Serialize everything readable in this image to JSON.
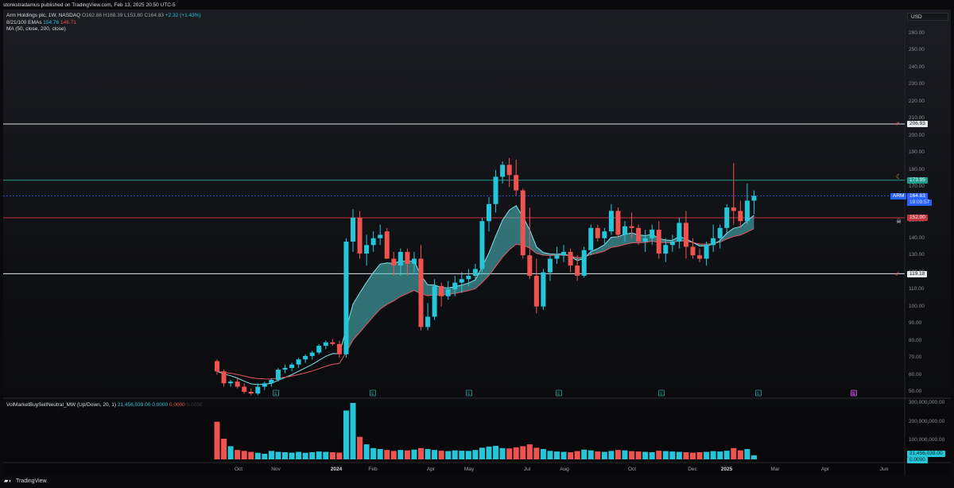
{
  "header": {
    "publish_line": "stonkstradamus published on TradingView.com, Feb 13, 2025 20:50 UTC-5"
  },
  "legend": {
    "symbol_line": "Arm Holdings plc, 1W, NASDAQ",
    "open": "O162.86",
    "high": "H168.39",
    "low": "L153.80",
    "close": "C164.83",
    "change": "+2.32 (+1.43%)",
    "ema_label": "8/21/100 EMAs",
    "ema_fast": "154.76",
    "ema_slow": "146.71",
    "ma_label": "MA (50, close, 200, close)",
    "vol_label": "VolMarketBuySellNeutral_MW (Up/Down, 20, 1)",
    "vol_v1": "21,456,039.00",
    "vol_v2": "0.0000",
    "vol_v3": "0.0000",
    "vol_v4": "0.0000"
  },
  "price_axis": {
    "currency": "USD",
    "ticks": [
      "260.00",
      "250.00",
      "240.00",
      "230.00",
      "220.00",
      "210.00",
      "200.00",
      "190.00",
      "180.00",
      "170.00",
      "160.00",
      "150.00",
      "140.00",
      "130.00",
      "120.00",
      "110.00",
      "100.00",
      "90.00",
      "80.00",
      "70.00",
      "60.00",
      "50.00"
    ],
    "badges": {
      "line_top": "206.93",
      "line_green": "173.95",
      "symbol": "ARM",
      "last": "164.83",
      "countdown": "19:09:57",
      "line_red": "152.00",
      "line_bottom": "119.18"
    }
  },
  "volume_axis": {
    "ticks": [
      "300,000,000.00",
      "200,000,000.00",
      "100,000,000.00"
    ],
    "value_badge": "21,456,039.00",
    "zero_badge": "0.0000"
  },
  "time_axis": {
    "labels": [
      "Oct",
      "Nov",
      "2024",
      "Feb",
      "Apr",
      "May",
      "Jul",
      "Aug",
      "Oct",
      "Dec",
      "2025",
      "Mar",
      "Apr",
      "Jun"
    ]
  },
  "events": {
    "earnings_label": "E"
  },
  "footer": {
    "brand": "TradingView"
  },
  "colors": {
    "up": "#26c6da",
    "down": "#ef5350",
    "line_white": "#dfe3ea",
    "line_green": "#1f9c8c",
    "line_red": "#c6353f",
    "band_fill": "#4fc3c9"
  },
  "chart_data": {
    "type": "candlestick",
    "interval": "1W",
    "price_scale": [
      50,
      265
    ],
    "horizontal_levels": [
      206.93,
      173.95,
      152.0,
      119.18
    ],
    "last_price": 164.83,
    "candles_ohlc": [
      [
        68,
        69,
        60,
        62
      ],
      [
        62,
        63,
        53,
        55
      ],
      [
        55,
        57,
        53,
        56
      ],
      [
        56,
        58,
        52,
        53
      ],
      [
        53,
        55,
        49,
        50
      ],
      [
        50,
        52,
        48,
        49
      ],
      [
        49,
        55,
        48,
        53
      ],
      [
        53,
        56,
        51,
        55
      ],
      [
        55,
        58,
        53,
        57
      ],
      [
        57,
        64,
        56,
        63
      ],
      [
        63,
        66,
        61,
        64
      ],
      [
        64,
        67,
        62,
        66
      ],
      [
        66,
        70,
        64,
        69
      ],
      [
        69,
        72,
        67,
        71
      ],
      [
        71,
        74,
        69,
        73
      ],
      [
        73,
        78,
        72,
        77
      ],
      [
        77,
        80,
        75,
        79
      ],
      [
        79,
        81,
        77,
        78
      ],
      [
        78,
        80,
        70,
        72
      ],
      [
        72,
        140,
        70,
        138
      ],
      [
        138,
        157,
        132,
        152
      ],
      [
        152,
        156,
        128,
        131
      ],
      [
        131,
        142,
        124,
        136
      ],
      [
        136,
        144,
        132,
        140
      ],
      [
        140,
        148,
        136,
        142
      ],
      [
        144,
        146,
        128,
        128
      ],
      [
        128,
        132,
        118,
        124
      ],
      [
        124,
        134,
        118,
        132
      ],
      [
        132,
        134,
        118,
        125
      ],
      [
        125,
        132,
        120,
        128
      ],
      [
        128,
        136,
        86,
        88
      ],
      [
        88,
        102,
        86,
        94
      ],
      [
        94,
        116,
        92,
        112
      ],
      [
        112,
        114,
        100,
        106
      ],
      [
        106,
        115,
        104,
        110
      ],
      [
        110,
        118,
        106,
        114
      ],
      [
        114,
        120,
        108,
        116
      ],
      [
        116,
        122,
        112,
        118
      ],
      [
        118,
        125,
        115,
        122
      ],
      [
        122,
        152,
        120,
        150
      ],
      [
        150,
        164,
        144,
        160
      ],
      [
        160,
        180,
        155,
        176
      ],
      [
        176,
        185,
        172,
        183
      ],
      [
        183,
        187,
        170,
        177
      ],
      [
        177,
        186,
        165,
        168
      ],
      [
        168,
        169,
        128,
        130
      ],
      [
        130,
        158,
        116,
        118
      ],
      [
        118,
        128,
        96,
        100
      ],
      [
        100,
        122,
        98,
        120
      ],
      [
        120,
        130,
        115,
        128
      ],
      [
        128,
        135,
        125,
        130
      ],
      [
        130,
        136,
        126,
        132
      ],
      [
        132,
        134,
        120,
        124
      ],
      [
        124,
        130,
        115,
        118
      ],
      [
        118,
        135,
        117,
        133
      ],
      [
        133,
        148,
        130,
        146
      ],
      [
        146,
        148,
        138,
        140
      ],
      [
        140,
        146,
        136,
        144
      ],
      [
        144,
        160,
        142,
        156
      ],
      [
        156,
        158,
        140,
        142
      ],
      [
        142,
        150,
        138,
        147
      ],
      [
        147,
        155,
        140,
        146
      ],
      [
        146,
        148,
        136,
        138
      ],
      [
        138,
        145,
        132,
        140
      ],
      [
        140,
        148,
        136,
        145
      ],
      [
        145,
        150,
        128,
        131
      ],
      [
        131,
        140,
        126,
        136
      ],
      [
        136,
        142,
        132,
        138
      ],
      [
        138,
        152,
        134,
        149
      ],
      [
        149,
        156,
        128,
        135
      ],
      [
        135,
        140,
        128,
        130
      ],
      [
        130,
        134,
        126,
        128
      ],
      [
        128,
        138,
        124,
        136
      ],
      [
        136,
        148,
        132,
        140
      ],
      [
        140,
        148,
        134,
        146
      ],
      [
        146,
        160,
        142,
        158
      ],
      [
        158,
        184,
        148,
        156
      ],
      [
        156,
        162,
        146,
        150
      ],
      [
        150,
        172,
        148,
        162
      ],
      [
        162,
        168,
        154,
        164.83
      ]
    ],
    "volume_millions": [
      200,
      110,
      70,
      50,
      45,
      40,
      35,
      30,
      45,
      40,
      38,
      36,
      40,
      35,
      38,
      42,
      40,
      38,
      36,
      260,
      300,
      120,
      80,
      60,
      55,
      50,
      45,
      50,
      48,
      52,
      60,
      55,
      50,
      46,
      44,
      48,
      46,
      45,
      50,
      62,
      68,
      72,
      60,
      58,
      64,
      70,
      80,
      62,
      55,
      45,
      42,
      40,
      38,
      44,
      52,
      48,
      42,
      40,
      45,
      50,
      48,
      44,
      42,
      40,
      38,
      46,
      44,
      42,
      40,
      38,
      36,
      38,
      40,
      44,
      42,
      46,
      60,
      48,
      55,
      21.456039
    ]
  }
}
